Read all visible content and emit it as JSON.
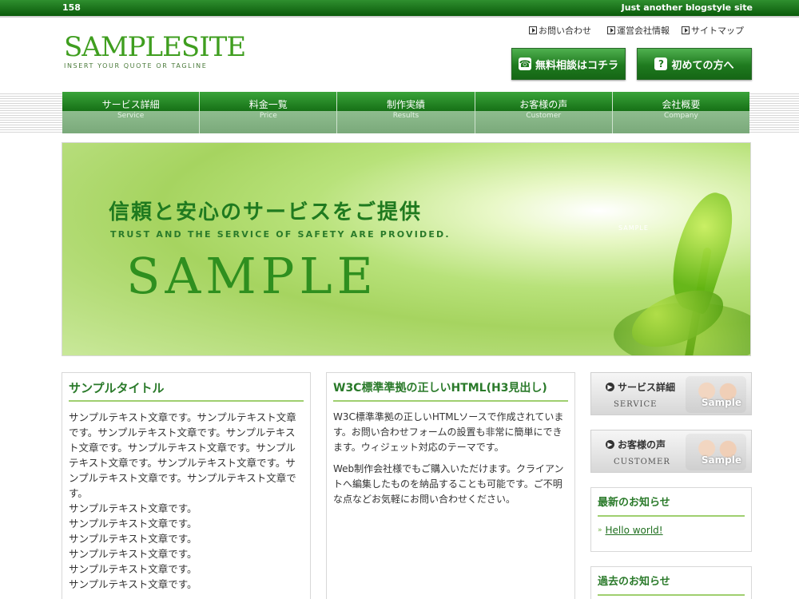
{
  "topbar": {
    "number": "158",
    "tagline": "Just another blogstyle site"
  },
  "logo": {
    "name": "SAMPLESITE",
    "tagline": "INSERT YOUR QUOTE OR TAGLINE"
  },
  "utility_links": [
    {
      "label": "お問い合わせ"
    },
    {
      "label": "運営会社情報"
    },
    {
      "label": "サイトマップ"
    }
  ],
  "header_buttons": [
    {
      "label": "無料相談はコチラ",
      "icon": "phone-icon"
    },
    {
      "label": "初めての方へ",
      "icon": "question-icon"
    }
  ],
  "nav": [
    {
      "jp": "サービス詳細",
      "en": "Service"
    },
    {
      "jp": "料金一覧",
      "en": "Price"
    },
    {
      "jp": "制作実績",
      "en": "Results"
    },
    {
      "jp": "お客様の声",
      "en": "Customer"
    },
    {
      "jp": "会社概要",
      "en": "Company"
    }
  ],
  "hero": {
    "heading": "信頼と安心のサービスをご提供",
    "sub": "TRUST AND THE SERVICE OF SAFETY ARE PROVIDED.",
    "big": "SAMPLE",
    "watermark": "SAMPLE"
  },
  "box1": {
    "title": "サンプルタイトル",
    "paragraph": "サンプルテキスト文章です。サンプルテキスト文章です。サンプルテキスト文章です。サンプルテキスト文章です。サンプルテキスト文章です。サンプルテキスト文章です。サンプルテキスト文章です。サンプルテキスト文章です。サンプルテキスト文章です。",
    "lines": [
      "サンプルテキスト文章です。",
      "サンプルテキスト文章です。",
      "サンプルテキスト文章です。",
      "サンプルテキスト文章です。",
      "サンプルテキスト文章です。",
      "サンプルテキスト文章です。"
    ]
  },
  "box2": {
    "title": "W3C標準準拠の正しいHTML(H3見出し)",
    "p1": "W3C標準準拠の正しいHTMLソースで作成されています。お問い合わせフォームの設置も非常に簡単にできます。ウィジェット対応のテーマです。",
    "p2": "Web制作会社様でもご購入いただけます。クライアントへ編集したものを納品することも可能です。ご不明な点などお気軽にお問い合わせください。"
  },
  "side_buttons": [
    {
      "label": "サービス詳細",
      "en": "SERVICE",
      "photo_text": "Sample"
    },
    {
      "label": "お客様の声",
      "en": "CUSTOMER",
      "photo_text": "Sample"
    }
  ],
  "news": {
    "title": "最新のお知らせ",
    "item": "Hello world!"
  },
  "past": {
    "title": "過去のお知らせ"
  }
}
